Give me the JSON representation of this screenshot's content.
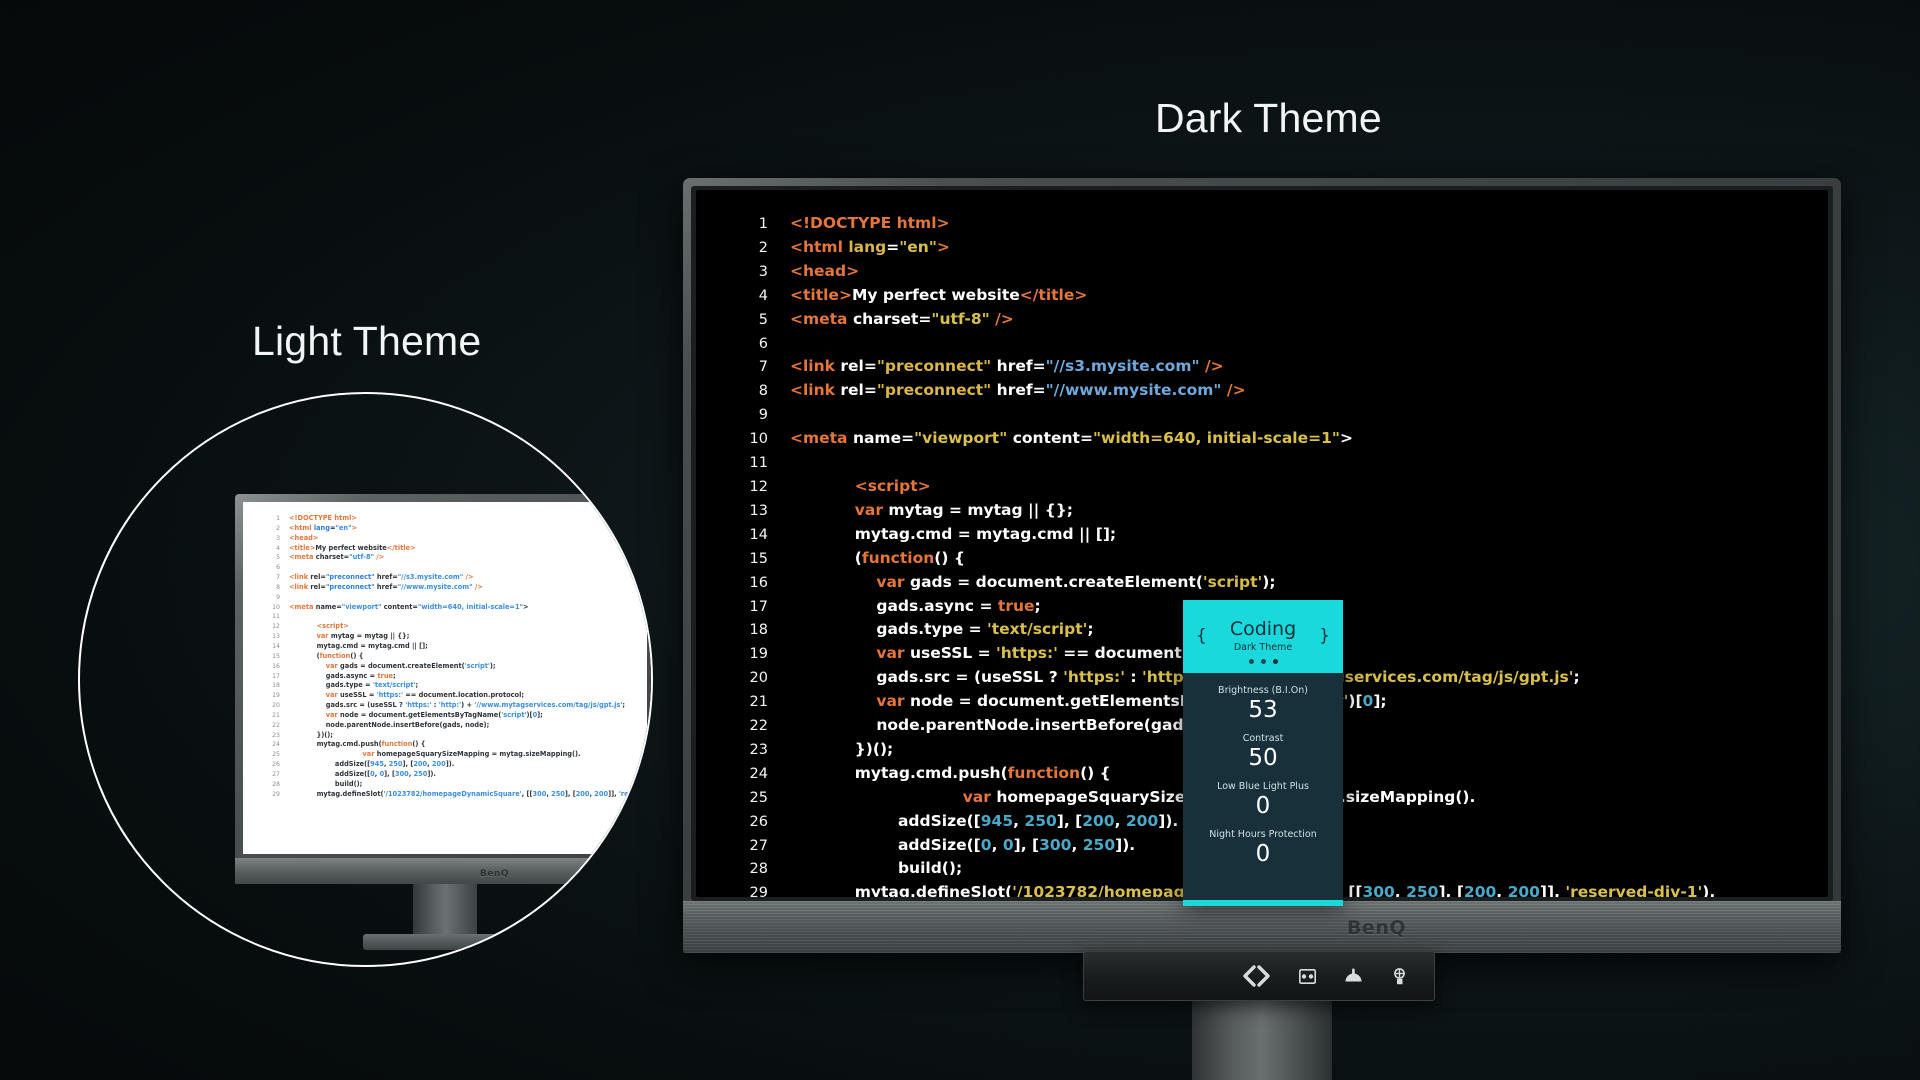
{
  "headings": {
    "dark": "Dark Theme",
    "light": "Light Theme"
  },
  "brand": {
    "logo": "BenQ"
  },
  "colors": {
    "background": "#0a1214",
    "osd_accent": "#1ad9dd",
    "osd_panel": "#17303a",
    "bezel": "#4a4e4f",
    "dark_code_bg": "#000000",
    "light_code_bg": "#ffffff",
    "tag": "#e2763b",
    "attr_value": "#d8c04a",
    "url": "#6fa8dc",
    "number": "#4aa8c8",
    "text": "#ffffff"
  },
  "osd": {
    "title": "Coding",
    "subtitle": "Dark Theme",
    "brace_left": "{",
    "brace_right": "}",
    "dots": 3,
    "active_dot": 3,
    "settings": [
      {
        "label": "Brightness (B.I.On)",
        "value": "53"
      },
      {
        "label": "Contrast",
        "value": "50"
      },
      {
        "label": "Low Blue Light Plus",
        "value": "0"
      },
      {
        "label": "Night Hours Protection",
        "value": "0"
      }
    ]
  },
  "control_bar": {
    "icons": [
      "code-brackets-icon",
      "eye-care-icon",
      "brightness-sensor-icon",
      "color-mode-icon"
    ]
  },
  "code": {
    "language": "html",
    "lines": [
      {
        "n": "1",
        "html": "<span class=\"tag\">&lt;!DOCTYPE html&gt;</span>"
      },
      {
        "n": "2",
        "html": "<span class=\"tag\">&lt;html</span> <span class=\"attr\">lang</span><span class=\"txt\">=</span><span class=\"val\">\"en\"</span><span class=\"tag\">&gt;</span>"
      },
      {
        "n": "3",
        "html": "<span class=\"tag\">&lt;head&gt;</span>"
      },
      {
        "n": "4",
        "html": "<span class=\"tag\">&lt;title&gt;</span><span class=\"txt\">My perfect website</span><span class=\"tag\">&lt;/title&gt;</span>"
      },
      {
        "n": "5",
        "html": "<span class=\"tag\">&lt;meta</span> <span class=\"txt\">charset=</span><span class=\"val\">\"utf-8\"</span> <span class=\"tag\">/&gt;</span>"
      },
      {
        "n": "6",
        "html": ""
      },
      {
        "n": "7",
        "html": "<span class=\"tag\">&lt;link</span> <span class=\"txt\">rel=</span><span class=\"attr\">\"preconnect\"</span> <span class=\"txt\">href=</span><span class=\"url\">\"//s3.mysite.com\"</span> <span class=\"tag\">/&gt;</span>"
      },
      {
        "n": "8",
        "html": "<span class=\"tag\">&lt;link</span> <span class=\"txt\">rel=</span><span class=\"attr\">\"preconnect\"</span> <span class=\"txt\">href=</span><span class=\"url\">\"//www.mysite.com\"</span> <span class=\"tag\">/&gt;</span>"
      },
      {
        "n": "9",
        "html": ""
      },
      {
        "n": "10",
        "html": "<span class=\"tag\">&lt;meta</span> <span class=\"txt\">name=</span><span class=\"val\">\"viewport\"</span> <span class=\"txt\">content=</span><span class=\"val\">\"width=640, initial-scale=1\"</span><span class=\"txt\">&gt;</span>"
      },
      {
        "n": "11",
        "html": ""
      },
      {
        "n": "12",
        "html": "            <span class=\"tag\">&lt;script&gt;</span>"
      },
      {
        "n": "13",
        "html": "            <span class=\"kw\">var</span> <span class=\"plain\">mytag = mytag || {};</span>"
      },
      {
        "n": "14",
        "html": "            <span class=\"plain\">mytag.cmd = mytag.cmd || [];</span>"
      },
      {
        "n": "15",
        "html": "            <span class=\"plain\">(</span><span class=\"fn\">function</span><span class=\"plain\">() {</span>"
      },
      {
        "n": "16",
        "html": "                <span class=\"kw\">var</span> <span class=\"plain\">gads = document.createElement(</span><span class=\"str\">'script'</span><span class=\"plain\">);</span>"
      },
      {
        "n": "17",
        "html": "                <span class=\"plain\">gads.async = </span><span class=\"kw\">true</span><span class=\"plain\">;</span>"
      },
      {
        "n": "18",
        "html": "                <span class=\"plain\">gads.type = </span><span class=\"str\">'text/script'</span><span class=\"plain\">;</span>"
      },
      {
        "n": "19",
        "html": "                <span class=\"kw\">var</span> <span class=\"plain\">useSSL = </span><span class=\"str\">'https:'</span><span class=\"plain\"> == document.location.protocol;</span>"
      },
      {
        "n": "20",
        "html": "                <span class=\"plain\">gads.src = (useSSL ? </span><span class=\"str\">'https:'</span><span class=\"plain\"> : </span><span class=\"str\">'http:'</span><span class=\"plain\">) + </span><span class=\"str\">'//www.mytagservices.com/tag/js/gpt.js'</span><span class=\"plain\">;</span>"
      },
      {
        "n": "21",
        "html": "                <span class=\"kw\">var</span> <span class=\"plain\">node = document.getElementsByTagName(</span><span class=\"str\">'script'</span><span class=\"plain\">)[</span><span class=\"num\">0</span><span class=\"plain\">];</span>"
      },
      {
        "n": "22",
        "html": "                <span class=\"plain\">node.parentNode.insertBefore(gads, node);</span>"
      },
      {
        "n": "23",
        "html": "            <span class=\"plain\">})();</span>"
      },
      {
        "n": "24",
        "html": "            <span class=\"plain\">mytag.cmd.push(</span><span class=\"fn\">function</span><span class=\"plain\">() {</span>"
      },
      {
        "n": "25",
        "html": "                                <span class=\"kw\">var</span> <span class=\"plain\">homepageSquarySizeMapping = mytag.sizeMapping().</span>"
      },
      {
        "n": "26",
        "html": "                    <span class=\"plain\">addSize([</span><span class=\"num\">945</span><span class=\"plain\">, </span><span class=\"num\">250</span><span class=\"plain\">], [</span><span class=\"num\">200</span><span class=\"plain\">, </span><span class=\"num\">200</span><span class=\"plain\">]).</span>"
      },
      {
        "n": "27",
        "html": "                    <span class=\"plain\">addSize([</span><span class=\"num\">0</span><span class=\"plain\">, </span><span class=\"num\">0</span><span class=\"plain\">], [</span><span class=\"num\">300</span><span class=\"plain\">, </span><span class=\"num\">250</span><span class=\"plain\">]).</span>"
      },
      {
        "n": "28",
        "html": "                    <span class=\"plain\">build();</span>"
      },
      {
        "n": "29",
        "html": "            <span class=\"plain\">mytag.defineSlot(</span><span class=\"str\">'/1023782/homepageDynamicSquare'</span><span class=\"plain\">, [[</span><span class=\"num\">300</span><span class=\"plain\">, </span><span class=\"num\">250</span><span class=\"plain\">], [</span><span class=\"num\">200</span><span class=\"plain\">, </span><span class=\"num\">200</span><span class=\"plain\">]], </span><span class=\"str\">'reserved-div-1'</span><span class=\"plain\">).</span>"
      }
    ]
  }
}
